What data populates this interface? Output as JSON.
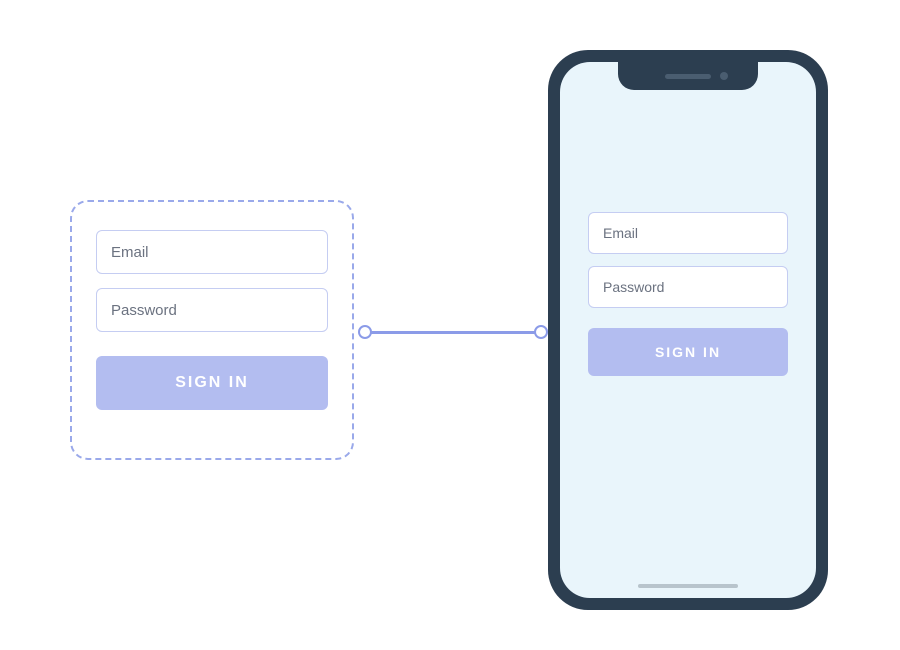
{
  "component": {
    "email_placeholder": "Email",
    "password_placeholder": "Password",
    "signin_label": "SIGN IN"
  },
  "phone": {
    "email_placeholder": "Email",
    "password_placeholder": "Password",
    "signin_label": "SIGN IN"
  }
}
